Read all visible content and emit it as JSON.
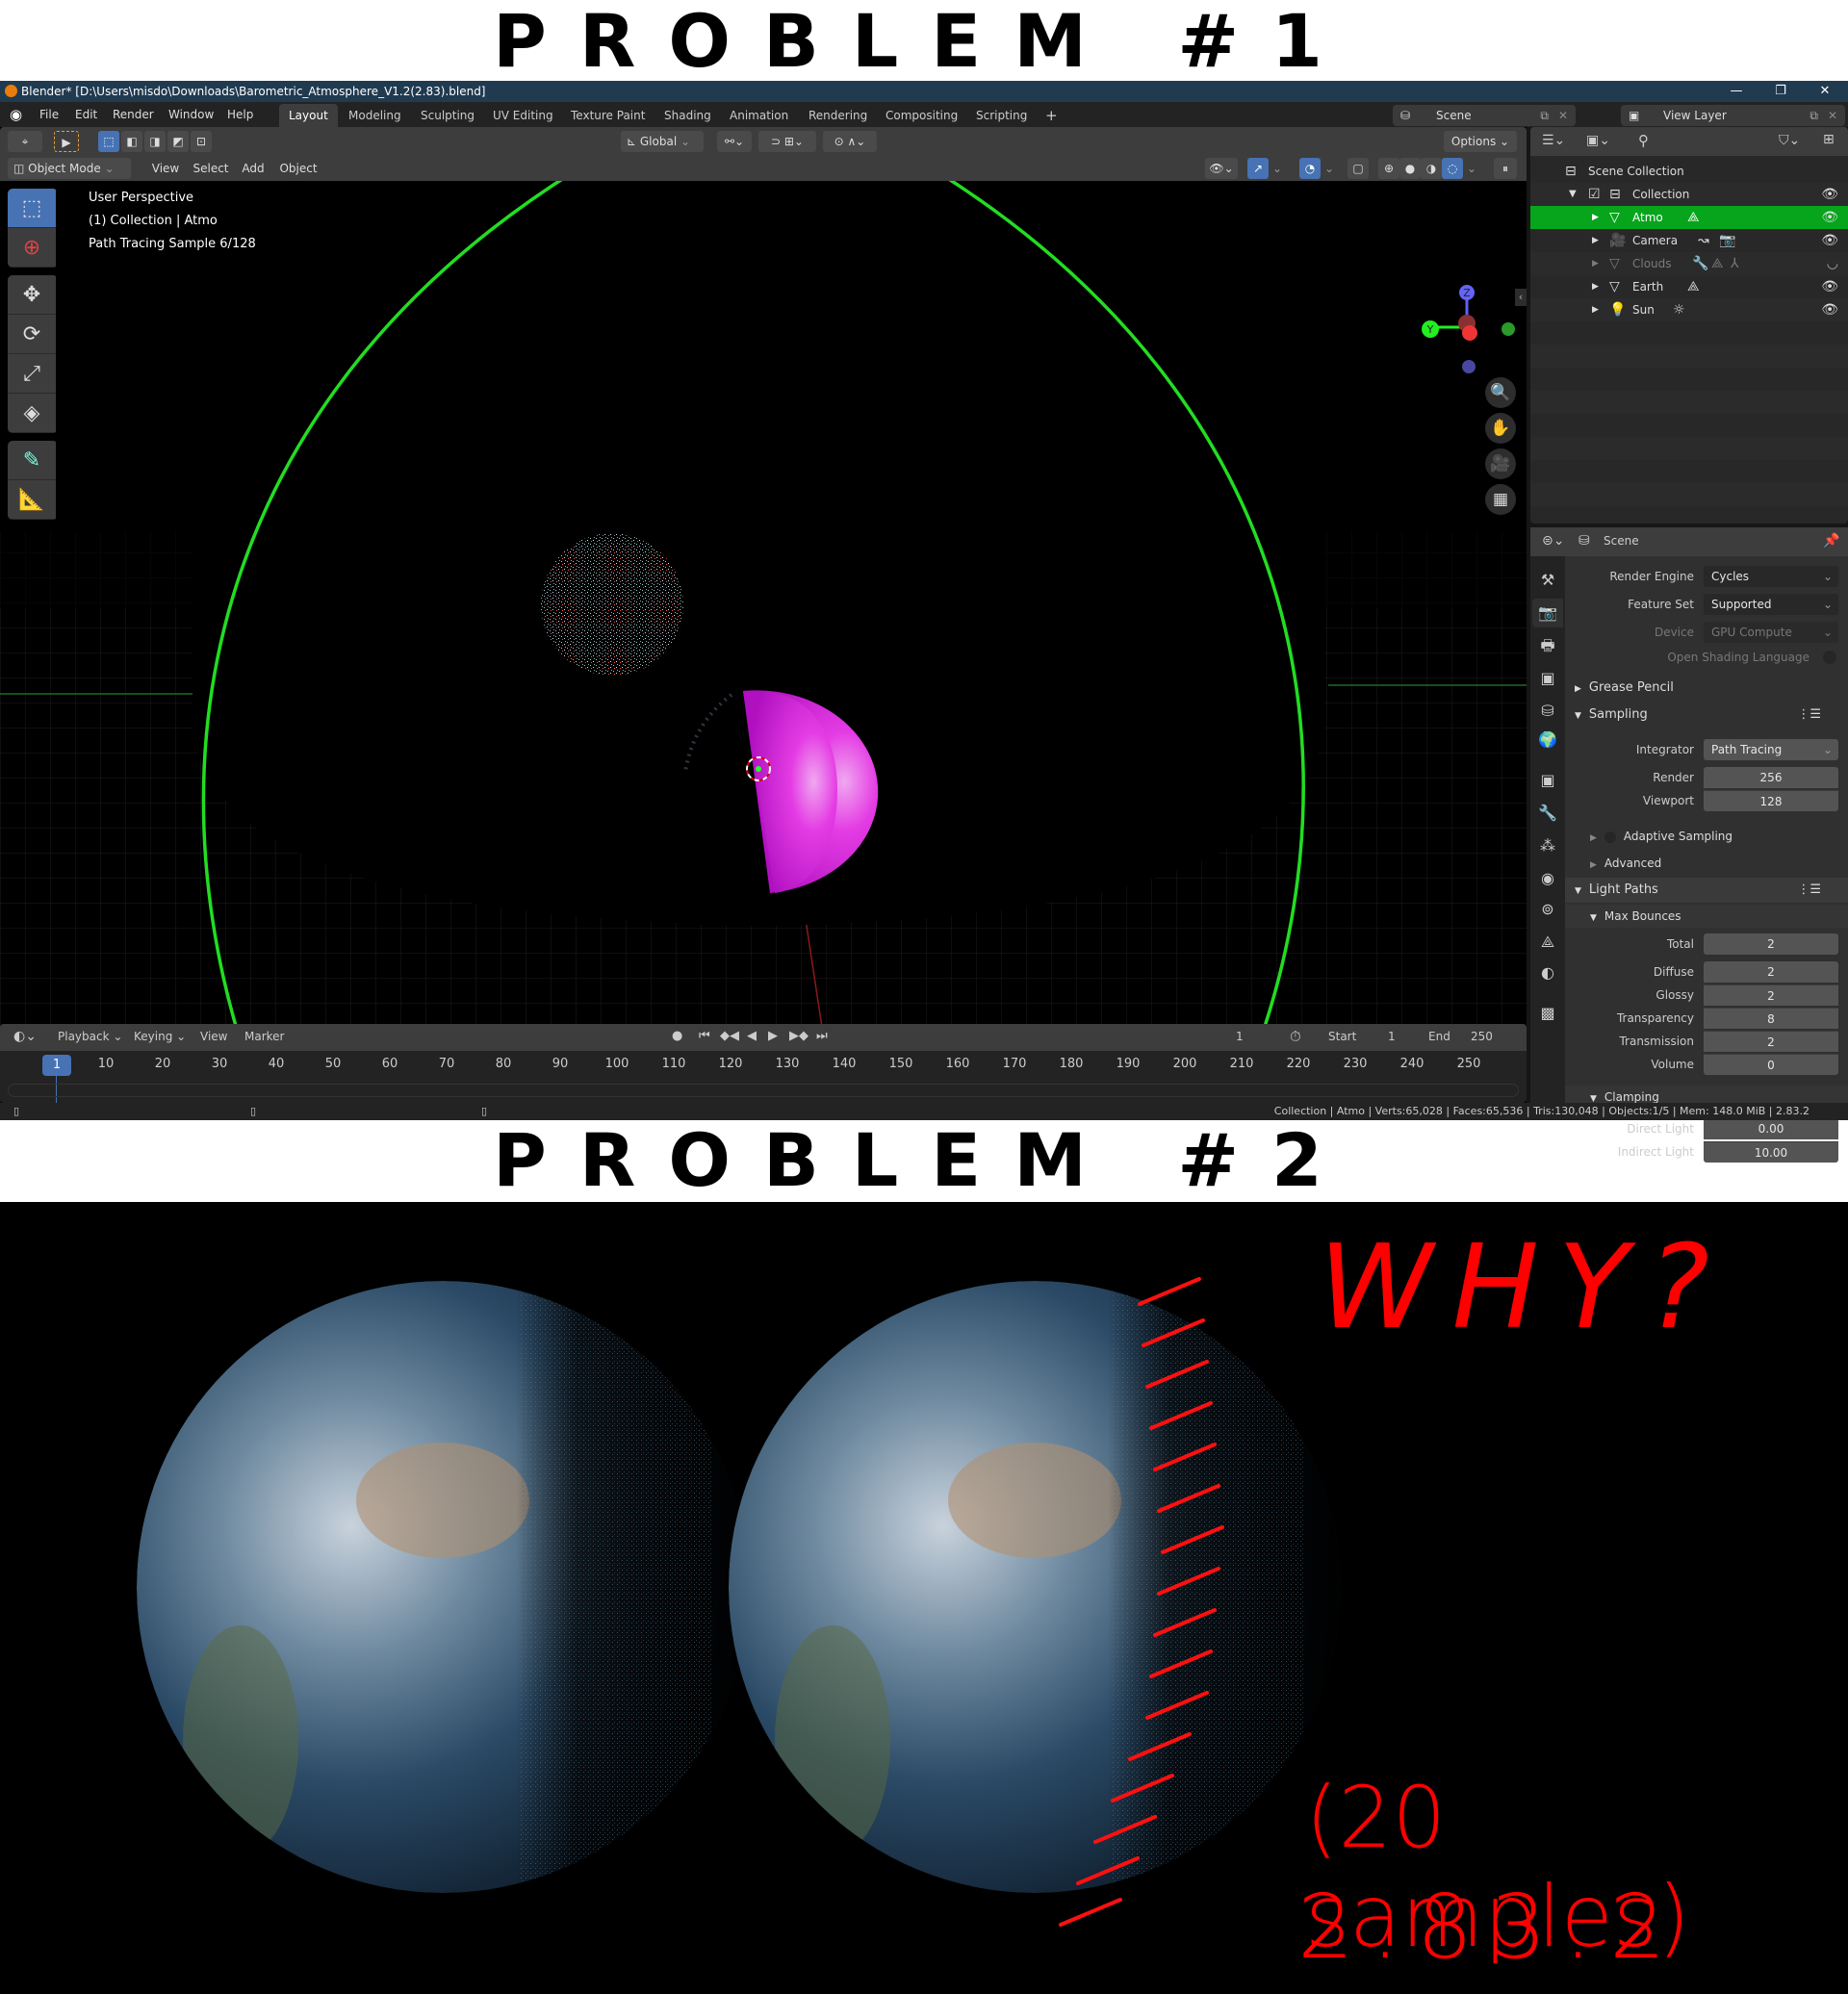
{
  "headings": {
    "problem1": "PROBLEM #1",
    "problem2": "PROBLEM #2"
  },
  "window": {
    "title": "Blender* [D:\\Users\\misdo\\Downloads\\Barometric_Atmosphere_V1.2(2.83).blend]",
    "controls": {
      "minimize": "—",
      "maximize": "❐",
      "close": "✕"
    }
  },
  "menu": [
    "File",
    "Edit",
    "Render",
    "Window",
    "Help"
  ],
  "workspaces": [
    "Layout",
    "Modeling",
    "Sculpting",
    "UV Editing",
    "Texture Paint",
    "Shading",
    "Animation",
    "Rendering",
    "Compositing",
    "Scripting"
  ],
  "workspace_add": "+",
  "scene_selector": {
    "scene": "Scene",
    "view_layer": "View Layer"
  },
  "viewport": {
    "transform_orientation": "Global",
    "options_label": "Options",
    "mode": "Object Mode",
    "header_menus": [
      "View",
      "Select",
      "Add",
      "Object"
    ],
    "overlay_lines": [
      "User Perspective",
      "(1) Collection | Atmo",
      "Path Tracing Sample 6/128"
    ],
    "gizmo_axes": {
      "z": "Z",
      "y": "Y",
      "x": "X"
    }
  },
  "outliner": {
    "root": "Scene Collection",
    "collection": "Collection",
    "items": [
      {
        "name": "Atmo",
        "selected": true,
        "visible": true
      },
      {
        "name": "Camera",
        "selected": false,
        "visible": true
      },
      {
        "name": "Clouds",
        "selected": false,
        "visible": false
      },
      {
        "name": "Earth",
        "selected": false,
        "visible": true
      },
      {
        "name": "Sun",
        "selected": false,
        "visible": true
      }
    ]
  },
  "properties": {
    "context": "Scene",
    "render_engine": {
      "label": "Render Engine",
      "value": "Cycles"
    },
    "feature_set": {
      "label": "Feature Set",
      "value": "Supported"
    },
    "device": {
      "label": "Device",
      "value": "GPU Compute"
    },
    "osl": {
      "label": "Open Shading Language",
      "checked": false
    },
    "grease_pencil": "Grease Pencil",
    "sampling": {
      "title": "Sampling",
      "integrator": {
        "label": "Integrator",
        "value": "Path Tracing"
      },
      "render": {
        "label": "Render",
        "value": "256"
      },
      "viewport": {
        "label": "Viewport",
        "value": "128"
      },
      "adaptive": "Adaptive Sampling",
      "advanced": "Advanced"
    },
    "light_paths": {
      "title": "Light Paths",
      "max_bounces": "Max Bounces",
      "bounces": [
        {
          "label": "Total",
          "value": "2"
        },
        {
          "label": "Diffuse",
          "value": "2"
        },
        {
          "label": "Glossy",
          "value": "2"
        },
        {
          "label": "Transparency",
          "value": "8"
        },
        {
          "label": "Transmission",
          "value": "2"
        },
        {
          "label": "Volume",
          "value": "0"
        }
      ],
      "clamping": "Clamping",
      "direct_light": {
        "label": "Direct Light",
        "value": "0.00"
      },
      "indirect_light": {
        "label": "Indirect Light",
        "value": "10.00"
      }
    }
  },
  "timeline": {
    "menus": [
      "Playback",
      "Keying",
      "View",
      "Marker"
    ],
    "current_frame": "1",
    "start_label": "Start",
    "start": "1",
    "end_label": "End",
    "end": "250",
    "ticks": [
      "1",
      "10",
      "20",
      "30",
      "40",
      "50",
      "60",
      "70",
      "80",
      "90",
      "100",
      "110",
      "120",
      "130",
      "140",
      "150",
      "160",
      "170",
      "180",
      "190",
      "200",
      "210",
      "220",
      "230",
      "240",
      "250"
    ]
  },
  "statusbar": "Collection | Atmo | Verts:65,028 | Faces:65,536 | Tris:130,048 | Objects:1/5 | Mem: 148.0 MiB | 2.83.2",
  "annotations": {
    "why": "WHY?",
    "samples": "(20 samples)",
    "version": "2.83.2"
  },
  "colors": {
    "accent": "#4772b3",
    "selection": "#06a51b",
    "title_bar": "#203a50",
    "annotation": "#ff0000",
    "atmo_outline": "#22dd22",
    "earth_placeholder": "#e030e0"
  }
}
